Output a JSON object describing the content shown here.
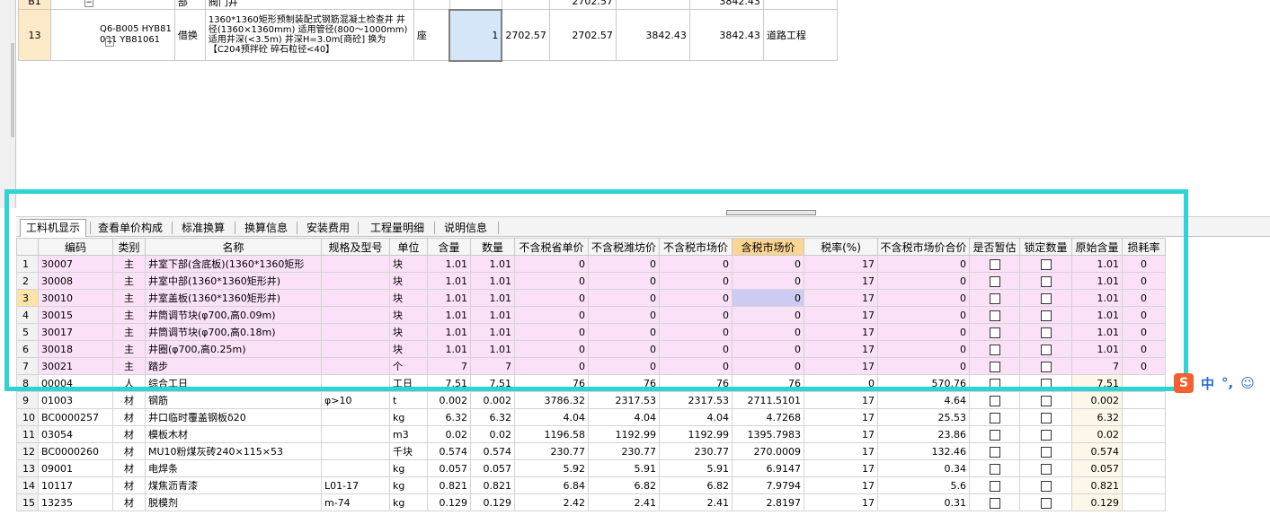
{
  "upper_grid": {
    "partial_row": {
      "idx": "B1",
      "minus": "−",
      "type": "部",
      "name": "阀门井",
      "price1": "2702.57",
      "total1": "3842.43"
    },
    "main_row": {
      "idx": "13",
      "plus": "+",
      "code_line1": "Q6-B005 HYB81",
      "code_line2": "031 YB81061",
      "type": "借换",
      "name": "1360*1360矩形预制装配式钢筋混凝土检查井 井径(1360×1360mm) 适用管径(800～1000mm) 适用井深(<3.5m) 井深H=3.0m[商砼] 换为【C204预拌砼 碎石粒径<40】",
      "unit": "座",
      "qty": "1",
      "price_a": "2702.57",
      "price_b": "2702.57",
      "total_a": "3842.43",
      "total_b": "3842.43",
      "profession": "道路工程"
    }
  },
  "tabs": [
    {
      "label": "工料机显示",
      "active": true
    },
    {
      "label": "查看单价构成",
      "active": false
    },
    {
      "label": "标准换算",
      "active": false
    },
    {
      "label": "换算信息",
      "active": false
    },
    {
      "label": "安装费用",
      "active": false
    },
    {
      "label": "工程量明细",
      "active": false
    },
    {
      "label": "说明信息",
      "active": false
    }
  ],
  "lower_grid": {
    "headers": [
      "",
      "编码",
      "类别",
      "名称",
      "规格及型号",
      "单位",
      "含量",
      "数量",
      "不含税省单价",
      "不含税潍坊价",
      "不含税市场价",
      "含税市场价",
      "税率(%)",
      "不含税市场价合价",
      "是否暂估",
      "锁定数量",
      "原始含量",
      "损耗率"
    ],
    "highlight_header_index": 11,
    "rows": [
      {
        "rn": "1",
        "code": "30007",
        "cat": "主",
        "name": "井室下部(含底板)(1360*1360矩形",
        "spec": "",
        "unit": "块",
        "content": "1.01",
        "qty": "1.01",
        "p1": "0",
        "p2": "0",
        "p3": "0",
        "p4": "0",
        "tax": "17",
        "sum": "0",
        "orig": "1.01",
        "loss": "0",
        "pink": true
      },
      {
        "rn": "2",
        "code": "30008",
        "cat": "主",
        "name": "井室中部(1360*1360矩形井)",
        "spec": "",
        "unit": "块",
        "content": "1.01",
        "qty": "1.01",
        "p1": "0",
        "p2": "0",
        "p3": "0",
        "p4": "0",
        "tax": "17",
        "sum": "0",
        "orig": "1.01",
        "loss": "0",
        "pink": true
      },
      {
        "rn": "3",
        "code": "30010",
        "cat": "主",
        "name": "井室盖板(1360*1360矩形井)",
        "spec": "",
        "unit": "块",
        "content": "1.01",
        "qty": "1.01",
        "p1": "0",
        "p2": "0",
        "p3": "0",
        "p4": "0",
        "tax": "17",
        "sum": "0",
        "orig": "1.01",
        "loss": "0",
        "pink": true
      },
      {
        "rn": "4",
        "code": "30015",
        "cat": "主",
        "name": "井筒调节块(φ700,高0.09m)",
        "spec": "",
        "unit": "块",
        "content": "1.01",
        "qty": "1.01",
        "p1": "0",
        "p2": "0",
        "p3": "0",
        "p4": "0",
        "tax": "17",
        "sum": "0",
        "orig": "1.01",
        "loss": "0",
        "pink": true
      },
      {
        "rn": "5",
        "code": "30017",
        "cat": "主",
        "name": "井筒调节块(φ700,高0.18m)",
        "spec": "",
        "unit": "块",
        "content": "1.01",
        "qty": "1.01",
        "p1": "0",
        "p2": "0",
        "p3": "0",
        "p4": "0",
        "tax": "17",
        "sum": "0",
        "orig": "1.01",
        "loss": "0",
        "pink": true
      },
      {
        "rn": "6",
        "code": "30018",
        "cat": "主",
        "name": "井圈(φ700,高0.25m)",
        "spec": "",
        "unit": "块",
        "content": "1.01",
        "qty": "1.01",
        "p1": "0",
        "p2": "0",
        "p3": "0",
        "p4": "0",
        "tax": "17",
        "sum": "0",
        "orig": "1.01",
        "loss": "0",
        "pink": true
      },
      {
        "rn": "7",
        "code": "30021",
        "cat": "主",
        "name": "踏步",
        "spec": "",
        "unit": "个",
        "content": "7",
        "qty": "7",
        "p1": "0",
        "p2": "0",
        "p3": "0",
        "p4": "0",
        "tax": "17",
        "sum": "0",
        "orig": "7",
        "loss": "0",
        "pink": true
      },
      {
        "rn": "8",
        "code": "00004",
        "cat": "人",
        "name": "综合工日",
        "spec": "",
        "unit": "工日",
        "content": "7.51",
        "qty": "7.51",
        "p1": "76",
        "p2": "76",
        "p3": "76",
        "p4": "76",
        "tax": "0",
        "sum": "570.76",
        "orig": "7.51",
        "loss": "",
        "pink": false
      },
      {
        "rn": "9",
        "code": "01003",
        "cat": "材",
        "name": "钢筋",
        "spec": "φ>10",
        "unit": "t",
        "content": "0.002",
        "qty": "0.002",
        "p1": "3786.32",
        "p2": "2317.53",
        "p3": "2317.53",
        "p4": "2711.5101",
        "tax": "17",
        "sum": "4.64",
        "orig": "0.002",
        "loss": "",
        "pink": false
      },
      {
        "rn": "10",
        "code": "BC0000257",
        "cat": "材",
        "name": "井口临时覆盖钢板δ20",
        "spec": "",
        "unit": "kg",
        "content": "6.32",
        "qty": "6.32",
        "p1": "4.04",
        "p2": "4.04",
        "p3": "4.04",
        "p4": "4.7268",
        "tax": "17",
        "sum": "25.53",
        "orig": "6.32",
        "loss": "",
        "pink": false
      },
      {
        "rn": "11",
        "code": "03054",
        "cat": "材",
        "name": "模板木材",
        "spec": "",
        "unit": "m3",
        "content": "0.02",
        "qty": "0.02",
        "p1": "1196.58",
        "p2": "1192.99",
        "p3": "1192.99",
        "p4": "1395.7983",
        "tax": "17",
        "sum": "23.86",
        "orig": "0.02",
        "loss": "",
        "pink": false
      },
      {
        "rn": "12",
        "code": "BC0000260",
        "cat": "材",
        "name": "MU10粉煤灰砖240×115×53",
        "spec": "",
        "unit": "千块",
        "content": "0.574",
        "qty": "0.574",
        "p1": "230.77",
        "p2": "230.77",
        "p3": "230.77",
        "p4": "270.0009",
        "tax": "17",
        "sum": "132.46",
        "orig": "0.574",
        "loss": "",
        "pink": false
      },
      {
        "rn": "13",
        "code": "09001",
        "cat": "材",
        "name": "电焊条",
        "spec": "",
        "unit": "kg",
        "content": "0.057",
        "qty": "0.057",
        "p1": "5.92",
        "p2": "5.91",
        "p3": "5.91",
        "p4": "6.9147",
        "tax": "17",
        "sum": "0.34",
        "orig": "0.057",
        "loss": "",
        "pink": false
      },
      {
        "rn": "14",
        "code": "10117",
        "cat": "材",
        "name": "煤焦沥青漆",
        "spec": "L01-17",
        "unit": "kg",
        "content": "0.821",
        "qty": "0.821",
        "p1": "6.84",
        "p2": "6.82",
        "p3": "6.82",
        "p4": "7.9794",
        "tax": "17",
        "sum": "5.6",
        "orig": "0.821",
        "loss": "",
        "pink": false
      },
      {
        "rn": "15",
        "code": "13235",
        "cat": "材",
        "name": "脱模剂",
        "spec": "m-74",
        "unit": "kg",
        "content": "0.129",
        "qty": "0.129",
        "p1": "2.42",
        "p2": "2.41",
        "p3": "2.41",
        "p4": "2.8197",
        "tax": "17",
        "sum": "0.31",
        "orig": "0.129",
        "loss": "",
        "pink": false
      }
    ],
    "current_row": "3"
  },
  "ime_bar": {
    "logo": "S",
    "mode": "中",
    "punct": "°,",
    "emoji": "☺"
  },
  "colors": {
    "highlight_border": "#2ed3d3",
    "pink_row": "#fbe1f7",
    "header_highlight": "#fcd494",
    "selected_cell": "#d5e6f8"
  }
}
